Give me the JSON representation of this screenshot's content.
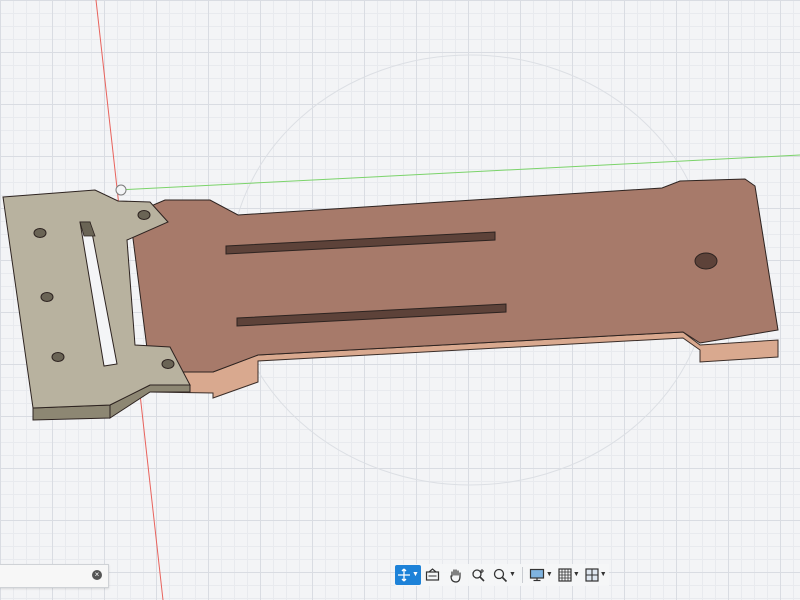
{
  "app": {
    "accent_color": "#1d82d8",
    "part_color": "#a77a6a",
    "part_side_color": "#d9a98f",
    "bracket_color": "#b8b29f",
    "axis_colors": {
      "x_axis": "#7bd36a",
      "y_axis": "#e8625c"
    }
  },
  "viewport": {
    "grid": "on",
    "origin_marker": "origin-icon"
  },
  "browser_panel": {
    "close_icon": "close-icon"
  },
  "nav_toolbar": {
    "items": [
      {
        "name": "orbit-tool",
        "icon": "orbit-icon",
        "active": true,
        "dropdown": true
      },
      {
        "name": "look-at-tool",
        "icon": "look-at-icon",
        "active": false,
        "dropdown": false
      },
      {
        "name": "pan-tool",
        "icon": "hand-icon",
        "active": false,
        "dropdown": false
      },
      {
        "name": "zoom-tool",
        "icon": "zoom-icon",
        "active": false,
        "dropdown": false
      },
      {
        "name": "fit-tool",
        "icon": "magnifier-icon",
        "active": false,
        "dropdown": true
      },
      {
        "name": "display-settings-tool",
        "icon": "monitor-icon",
        "active": false,
        "dropdown": true
      },
      {
        "name": "grid-snaps-tool",
        "icon": "grid-icon",
        "active": false,
        "dropdown": true
      },
      {
        "name": "viewports-tool",
        "icon": "viewports-icon",
        "active": false,
        "dropdown": true
      }
    ]
  }
}
